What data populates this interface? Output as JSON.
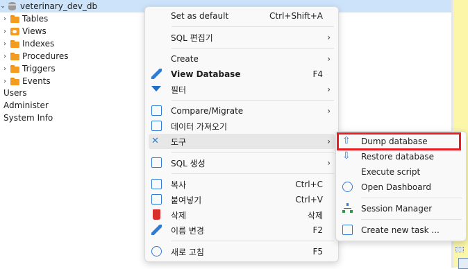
{
  "tree": {
    "db_name": "veterinary_dev_db",
    "folders": [
      {
        "label": "Tables",
        "icon": "folder-icon"
      },
      {
        "label": "Views",
        "icon": "view-folder-icon"
      },
      {
        "label": "Indexes",
        "icon": "folder-icon"
      },
      {
        "label": "Procedures",
        "icon": "folder-icon"
      },
      {
        "label": "Triggers",
        "icon": "folder-icon"
      },
      {
        "label": "Events",
        "icon": "folder-icon"
      }
    ],
    "plain_items": [
      "Users",
      "Administer",
      "System Info"
    ]
  },
  "context_menu": {
    "items": [
      {
        "label": "Set as default",
        "shortcut": "Ctrl+Shift+A"
      },
      {
        "label": "SQL 편집기",
        "arrow": "›"
      },
      {
        "label": "Create",
        "arrow": "›"
      },
      {
        "label": "View Database",
        "shortcut": "F4",
        "icon": "pencil-icon"
      },
      {
        "label": "필터",
        "arrow": "›",
        "icon": "filter-icon"
      },
      {
        "label": "Compare/Migrate",
        "arrow": "›",
        "icon": "compare-icon"
      },
      {
        "label": "데이터 가져오기",
        "icon": "import-data-icon"
      },
      {
        "label": "도구",
        "arrow": "›",
        "icon": "tools-icon"
      },
      {
        "label": "SQL 생성",
        "arrow": "›",
        "icon": "sql-icon"
      },
      {
        "label": "복사",
        "shortcut": "Ctrl+C",
        "icon": "copy-icon"
      },
      {
        "label": "붙여넣기",
        "shortcut": "Ctrl+V",
        "icon": "paste-icon"
      },
      {
        "label": "삭제",
        "shortcut": "삭제",
        "icon": "delete-icon"
      },
      {
        "label": "이름 변경",
        "shortcut": "F2",
        "icon": "rename-icon"
      },
      {
        "label": "새로 고침",
        "shortcut": "F5",
        "icon": "refresh-icon"
      }
    ]
  },
  "tools_submenu": {
    "items": [
      {
        "label": "Dump database",
        "icon": "upload-icon"
      },
      {
        "label": "Restore database",
        "icon": "download-icon"
      },
      {
        "label": "Execute script",
        "icon": ""
      },
      {
        "label": "Open Dashboard",
        "icon": "dashboard-icon"
      },
      {
        "label": "Session Manager",
        "icon": "session-tree-icon"
      },
      {
        "label": "Create new task ...",
        "icon": "task-icon"
      }
    ]
  },
  "colors": {
    "selection": "#cde3fa",
    "highlight_box": "#e81c23",
    "folder": "#f39c1f",
    "accent_blue": "#2f7bd6"
  }
}
